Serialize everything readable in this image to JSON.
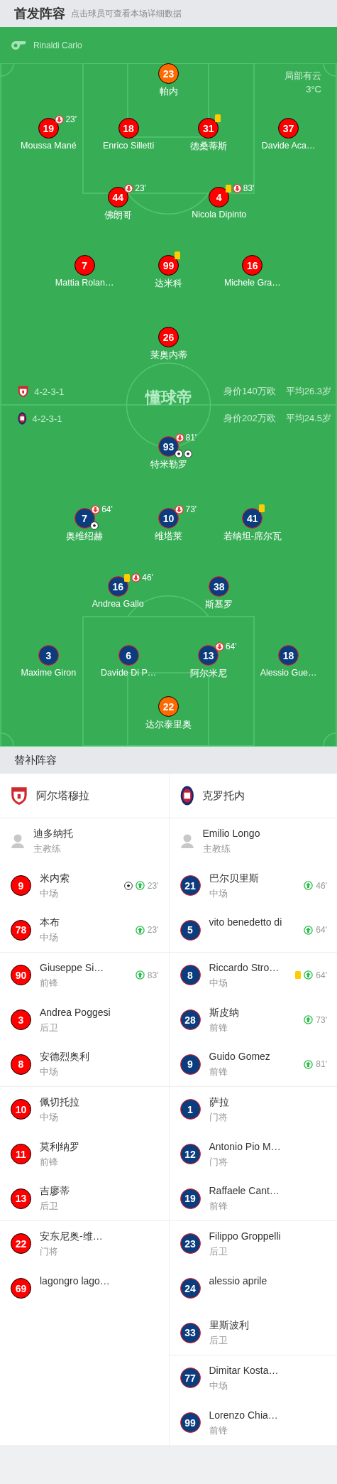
{
  "header": {
    "title": "首发阵容",
    "hint": "点击球员可查看本场详细数据"
  },
  "referee": {
    "name": "Rinaldi Carlo"
  },
  "weather": {
    "condition": "局部有云",
    "temperature": "3°C"
  },
  "pitch_logo": "懂球帝",
  "teams": [
    {
      "name": "阿尔塔穆拉",
      "color": "#ff0000",
      "formation": "4-2-3-1",
      "market_value": "身价140万欧",
      "average_age": "平均26.3岁",
      "lines": [
        [
          {
            "number": "23",
            "name": "帕内",
            "kind": "goalkeeper"
          }
        ],
        [
          {
            "number": "19",
            "name": "Moussa Mané",
            "kind": "outfield",
            "events": [
              {
                "kind": "sub_off",
                "minute": "23'"
              }
            ]
          },
          {
            "number": "18",
            "name": "Enrico Silletti",
            "kind": "outfield"
          },
          {
            "number": "31",
            "name": "德桑蒂斯",
            "kind": "outfield",
            "events": [
              {
                "kind": "yellow_card"
              }
            ]
          },
          {
            "number": "37",
            "name": "Davide Aca…",
            "kind": "outfield"
          }
        ],
        [
          {
            "number": "44",
            "name": "佛朗哥",
            "kind": "outfield",
            "events": [
              {
                "kind": "sub_off",
                "minute": "23'"
              }
            ]
          },
          {
            "number": "4",
            "name": "Nicola Dipinto",
            "kind": "outfield",
            "events": [
              {
                "kind": "yellow_card"
              },
              {
                "kind": "sub_off",
                "minute": "83'"
              }
            ]
          }
        ],
        [
          {
            "number": "7",
            "name": "Mattia Rolan…",
            "kind": "outfield"
          },
          {
            "number": "99",
            "name": "达米科",
            "kind": "outfield",
            "events": [
              {
                "kind": "yellow_card"
              }
            ]
          },
          {
            "number": "16",
            "name": "Michele Gra…",
            "kind": "outfield"
          }
        ],
        [
          {
            "number": "26",
            "name": "莱奥内蒂",
            "kind": "outfield"
          }
        ]
      ],
      "coach": {
        "name": "迪多纳托",
        "role": "主教练"
      },
      "substitutes": [
        {
          "number": "9",
          "name": "米内索",
          "position": "中场",
          "events": [
            {
              "kind": "goal"
            },
            {
              "kind": "sub_on",
              "minute": "23'"
            }
          ]
        },
        {
          "number": "78",
          "name": "本布",
          "position": "中场",
          "events": [
            {
              "kind": "sub_on",
              "minute": "23'"
            }
          ]
        },
        {
          "number": "90",
          "name": "Giuseppe Si…",
          "position": "前锋",
          "events": [
            {
              "kind": "sub_on",
              "minute": "83'"
            }
          ]
        },
        {
          "number": "3",
          "name": "Andrea Poggesi",
          "position": "后卫"
        },
        {
          "number": "8",
          "name": "安德烈奥利",
          "position": "中场"
        },
        {
          "number": "10",
          "name": "佩切托拉",
          "position": "中场"
        },
        {
          "number": "11",
          "name": "莫利纳罗",
          "position": "前锋"
        },
        {
          "number": "13",
          "name": "吉廖蒂",
          "position": "后卫"
        },
        {
          "number": "22",
          "name": "安东尼奥-维…",
          "position": "门将"
        },
        {
          "number": "69",
          "name": "lagongro lago…"
        }
      ]
    },
    {
      "name": "克罗托内",
      "color": "#0b3d7e",
      "formation": "4-2-3-1",
      "market_value": "身价202万欧",
      "average_age": "平均24.5岁",
      "lines": [
        [
          {
            "number": "93",
            "name": "特米勒罗",
            "kind": "outfield",
            "events": [
              {
                "kind": "sub_off",
                "minute": "81'"
              },
              {
                "kind": "goal"
              },
              {
                "kind": "goal"
              }
            ]
          }
        ],
        [
          {
            "number": "7",
            "name": "奥维绍赫",
            "kind": "outfield",
            "events": [
              {
                "kind": "sub_off",
                "minute": "64'"
              },
              {
                "kind": "goal"
              }
            ]
          },
          {
            "number": "10",
            "name": "维塔莱",
            "kind": "outfield",
            "events": [
              {
                "kind": "sub_off",
                "minute": "73'"
              }
            ]
          },
          {
            "number": "41",
            "name": "若纳坦-席尔瓦",
            "kind": "outfield",
            "events": [
              {
                "kind": "yellow_card"
              }
            ]
          }
        ],
        [
          {
            "number": "16",
            "name": "Andrea Gallo",
            "kind": "outfield",
            "events": [
              {
                "kind": "yellow_card"
              },
              {
                "kind": "sub_off",
                "minute": "46'"
              }
            ]
          },
          {
            "number": "38",
            "name": "斯基罗",
            "kind": "outfield"
          }
        ],
        [
          {
            "number": "3",
            "name": "Maxime Giron",
            "kind": "outfield"
          },
          {
            "number": "6",
            "name": "Davide Di P…",
            "kind": "outfield"
          },
          {
            "number": "13",
            "name": "阿尔米尼",
            "kind": "outfield",
            "events": [
              {
                "kind": "sub_off",
                "minute": "64'"
              }
            ]
          },
          {
            "number": "18",
            "name": "Alessio Gue…",
            "kind": "outfield"
          }
        ],
        [
          {
            "number": "22",
            "name": "达尔泰里奥",
            "kind": "goalkeeper"
          }
        ]
      ],
      "coach": {
        "name": "Emilio Longo",
        "role": "主教练"
      },
      "substitutes": [
        {
          "number": "21",
          "name": "巴尔贝里斯",
          "position": "中场",
          "events": [
            {
              "kind": "sub_on",
              "minute": "46'"
            }
          ]
        },
        {
          "number": "5",
          "name": "vito benedetto di",
          "events": [
            {
              "kind": "sub_on",
              "minute": "64'"
            }
          ]
        },
        {
          "number": "8",
          "name": "Riccardo Stro…",
          "position": "中场",
          "events": [
            {
              "kind": "yellow_card"
            },
            {
              "kind": "sub_on",
              "minute": "64'"
            }
          ]
        },
        {
          "number": "28",
          "name": "斯皮纳",
          "position": "前锋",
          "events": [
            {
              "kind": "sub_on",
              "minute": "73'"
            }
          ]
        },
        {
          "number": "9",
          "name": "Guido Gomez",
          "position": "前锋",
          "events": [
            {
              "kind": "sub_on",
              "minute": "81'"
            }
          ]
        },
        {
          "number": "1",
          "name": "萨拉",
          "position": "门将"
        },
        {
          "number": "12",
          "name": "Antonio Pio M…",
          "position": "门将"
        },
        {
          "number": "19",
          "name": "Raffaele Cant…",
          "position": "前锋"
        },
        {
          "number": "23",
          "name": "Filippo Groppelli",
          "position": "后卫"
        },
        {
          "number": "24",
          "name": "alessio aprile"
        },
        {
          "number": "33",
          "name": "里斯波利",
          "position": "后卫"
        },
        {
          "number": "77",
          "name": "Dimitar Kosta…",
          "position": "中场"
        },
        {
          "number": "99",
          "name": "Lorenzo Chia…",
          "position": "前锋"
        }
      ]
    }
  ],
  "substitutes_title": "替补阵容"
}
